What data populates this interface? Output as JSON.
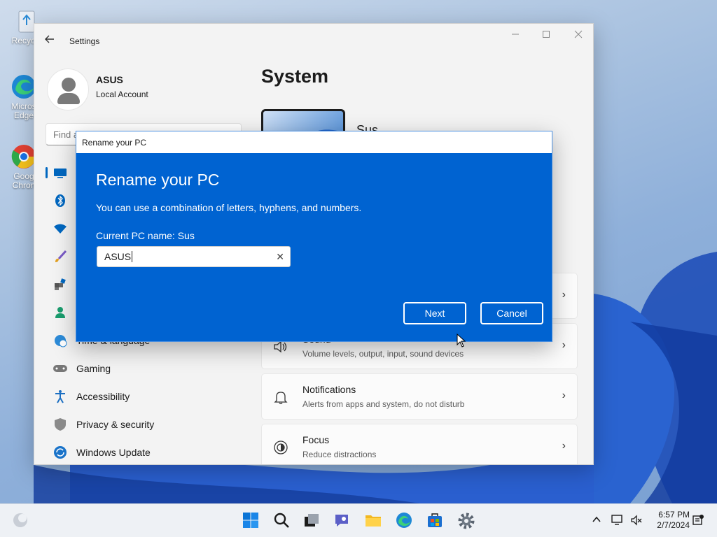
{
  "desktop": {
    "icons": [
      {
        "label_line1": "Recycle",
        "label_line2": ""
      },
      {
        "label_line1": "Micros",
        "label_line2": "Edge"
      },
      {
        "label_line1": "Goog",
        "label_line2": "Chron"
      }
    ]
  },
  "settings_window": {
    "title": "Settings",
    "profile": {
      "name": "ASUS",
      "account_type": "Local Account"
    },
    "search_placeholder": "Find a setting",
    "nav_items": [
      {
        "label": "",
        "icon": "system-icon",
        "active": true
      },
      {
        "label": "",
        "icon": "bluetooth-icon"
      },
      {
        "label": "",
        "icon": "wifi-icon"
      },
      {
        "label": "",
        "icon": "personalization-brush-icon"
      },
      {
        "label": "",
        "icon": "apps-icon"
      },
      {
        "label": "",
        "icon": "accounts-person-icon"
      },
      {
        "label": "Time & language",
        "icon": "globe-clock-icon"
      },
      {
        "label": "Gaming",
        "icon": "gamepad-icon"
      },
      {
        "label": "Accessibility",
        "icon": "accessibility-icon"
      },
      {
        "label": "Privacy & security",
        "icon": "shield-icon"
      },
      {
        "label": "Windows Update",
        "icon": "update-icon"
      }
    ],
    "page_title": "System",
    "pc_name_display": "Sus",
    "cards": [
      {
        "title": "",
        "subtitle": ""
      },
      {
        "title": "Sound",
        "subtitle": "Volume levels, output, input, sound devices",
        "icon": "speaker-icon"
      },
      {
        "title": "Notifications",
        "subtitle": "Alerts from apps and system, do not disturb",
        "icon": "bell-icon"
      },
      {
        "title": "Focus",
        "subtitle": "Reduce distractions",
        "icon": "focus-icon"
      }
    ]
  },
  "rename_dialog": {
    "window_title": "Rename your PC",
    "heading": "Rename your PC",
    "description": "You can use a combination of letters, hyphens, and numbers.",
    "current_name_label": "Current PC name: Sus",
    "input_value": "ASUS",
    "next_label": "Next",
    "cancel_label": "Cancel"
  },
  "taskbar": {
    "time": "6:57 PM",
    "date": "2/7/2024"
  },
  "colors": {
    "dialog_blue": "#0063d1",
    "accent": "#0067c0"
  }
}
